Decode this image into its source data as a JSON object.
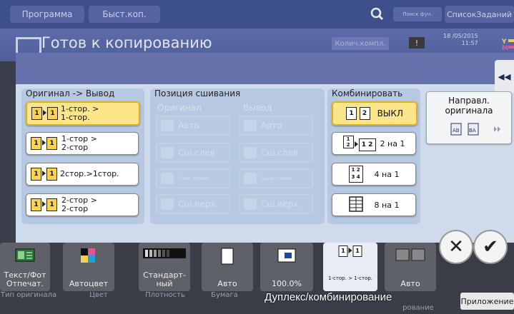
{
  "topbar": {
    "program_label": "Программа",
    "quick_copy_label": "Быст.коп.",
    "search_label": "Поиск фун.",
    "job_list_label": "СписокЗаданий"
  },
  "status": {
    "title": "Готов к копированию",
    "copies_label": "Колич.компл.",
    "warning_symbol": "!",
    "date": "18 /05/2015",
    "time": "11:57"
  },
  "panel": {
    "collapse_symbol": "◂◂",
    "original_output": {
      "title": "Оригинал -> Вывод",
      "options": [
        {
          "label_line1": "1-стор. >",
          "label_line2": "1-стор.",
          "selected": true
        },
        {
          "label_line1": "1-стор >",
          "label_line2": "2-стор",
          "selected": false
        },
        {
          "label_line1": "2стор.>1стор.",
          "label_line2": "",
          "selected": false
        },
        {
          "label_line1": "2-стор >",
          "label_line2": "2-стор",
          "selected": false
        }
      ]
    },
    "binding": {
      "title": "Позиция сшивания",
      "original_label": "Оригинал",
      "output_label": "Вывод",
      "original_options": [
        "Авто",
        "Сш.слев",
        "Сшив. справа",
        "Сш.верх"
      ],
      "output_options": [
        "Авто",
        "Сш.слев",
        "Сшив. справа",
        "Сш.верх"
      ]
    },
    "combine": {
      "title": "Комбинировать",
      "options": [
        {
          "label": "ВЫКЛ",
          "selected": true
        },
        {
          "label": "2 на 1",
          "selected": false
        },
        {
          "label": "4 на 1",
          "selected": false
        },
        {
          "label": "8 на 1",
          "selected": false
        }
      ]
    },
    "direction": {
      "label_line1": "Направл.",
      "label_line2": "оригинала"
    }
  },
  "actions": {
    "cancel_symbol": "✕",
    "ok_symbol": "✔"
  },
  "bottom": {
    "tiles": [
      {
        "label": "Текст/Фот Отпечат."
      },
      {
        "label": "Автоцвет"
      },
      {
        "label": "Стандарт-ный"
      },
      {
        "label": "Авто"
      },
      {
        "label": "100.0%"
      },
      {
        "label": "1-стор. > 1-стор."
      },
      {
        "label": "Авто"
      }
    ],
    "captions": [
      "Тип оригинала",
      "Цвет",
      "Плотность",
      "Бумага"
    ],
    "current_function": "Дуплекс/комбинирование",
    "hidden_caption": "рование",
    "apps_label": "Приложение"
  }
}
